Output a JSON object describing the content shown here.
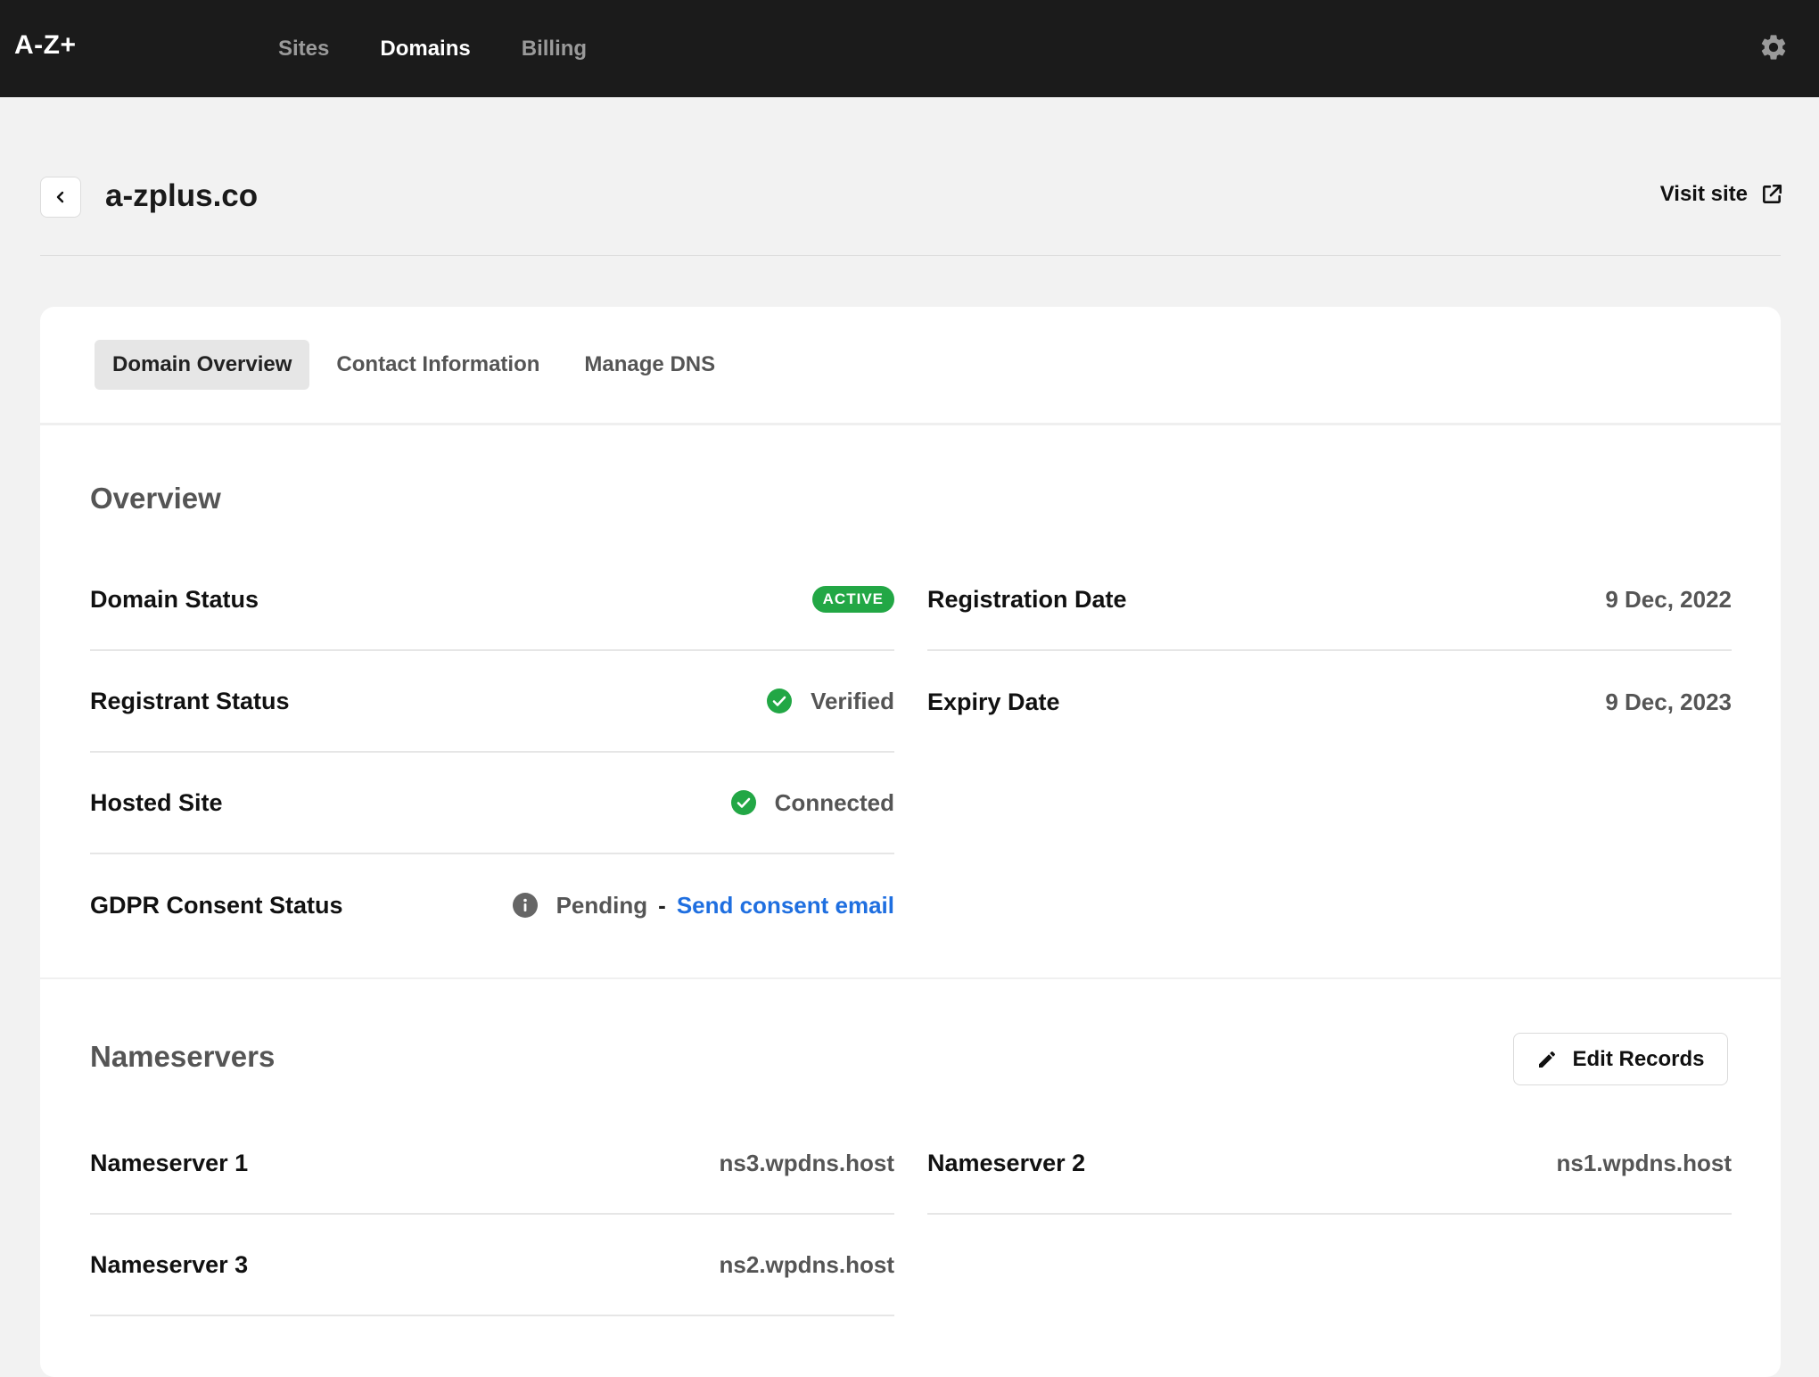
{
  "app": {
    "logo": "A-Z+",
    "nav": [
      {
        "label": "Sites",
        "active": false
      },
      {
        "label": "Domains",
        "active": true
      },
      {
        "label": "Billing",
        "active": false
      }
    ],
    "settings_icon": "gear-icon"
  },
  "header": {
    "title": "a-zplus.co",
    "visit_site_label": "Visit site",
    "back_icon": "chevron-left-icon",
    "external_icon": "external-link-icon"
  },
  "tabs": [
    {
      "label": "Domain Overview",
      "active": true
    },
    {
      "label": "Contact Information",
      "active": false
    },
    {
      "label": "Manage DNS",
      "active": false
    }
  ],
  "overview": {
    "title": "Overview",
    "domain_status": {
      "label": "Domain Status",
      "badge": "ACTIVE"
    },
    "registrant_status": {
      "label": "Registrant Status",
      "value": "Verified"
    },
    "hosted_site": {
      "label": "Hosted Site",
      "value": "Connected"
    },
    "gdpr": {
      "label": "GDPR Consent Status",
      "value": "Pending",
      "separator": "-",
      "link": "Send consent email"
    },
    "registration_date": {
      "label": "Registration Date",
      "value": "9 Dec, 2022"
    },
    "expiry_date": {
      "label": "Expiry Date",
      "value": "9 Dec, 2023"
    }
  },
  "nameservers": {
    "title": "Nameservers",
    "edit_label": "Edit Records",
    "items": [
      {
        "label": "Nameserver 1",
        "value": "ns3.wpdns.host"
      },
      {
        "label": "Nameserver 2",
        "value": "ns1.wpdns.host"
      },
      {
        "label": "Nameserver 3",
        "value": "ns2.wpdns.host"
      }
    ]
  },
  "colors": {
    "topbar": "#1b1b1b",
    "success": "#22a745",
    "link": "#1f6fe0",
    "info": "#666666"
  }
}
